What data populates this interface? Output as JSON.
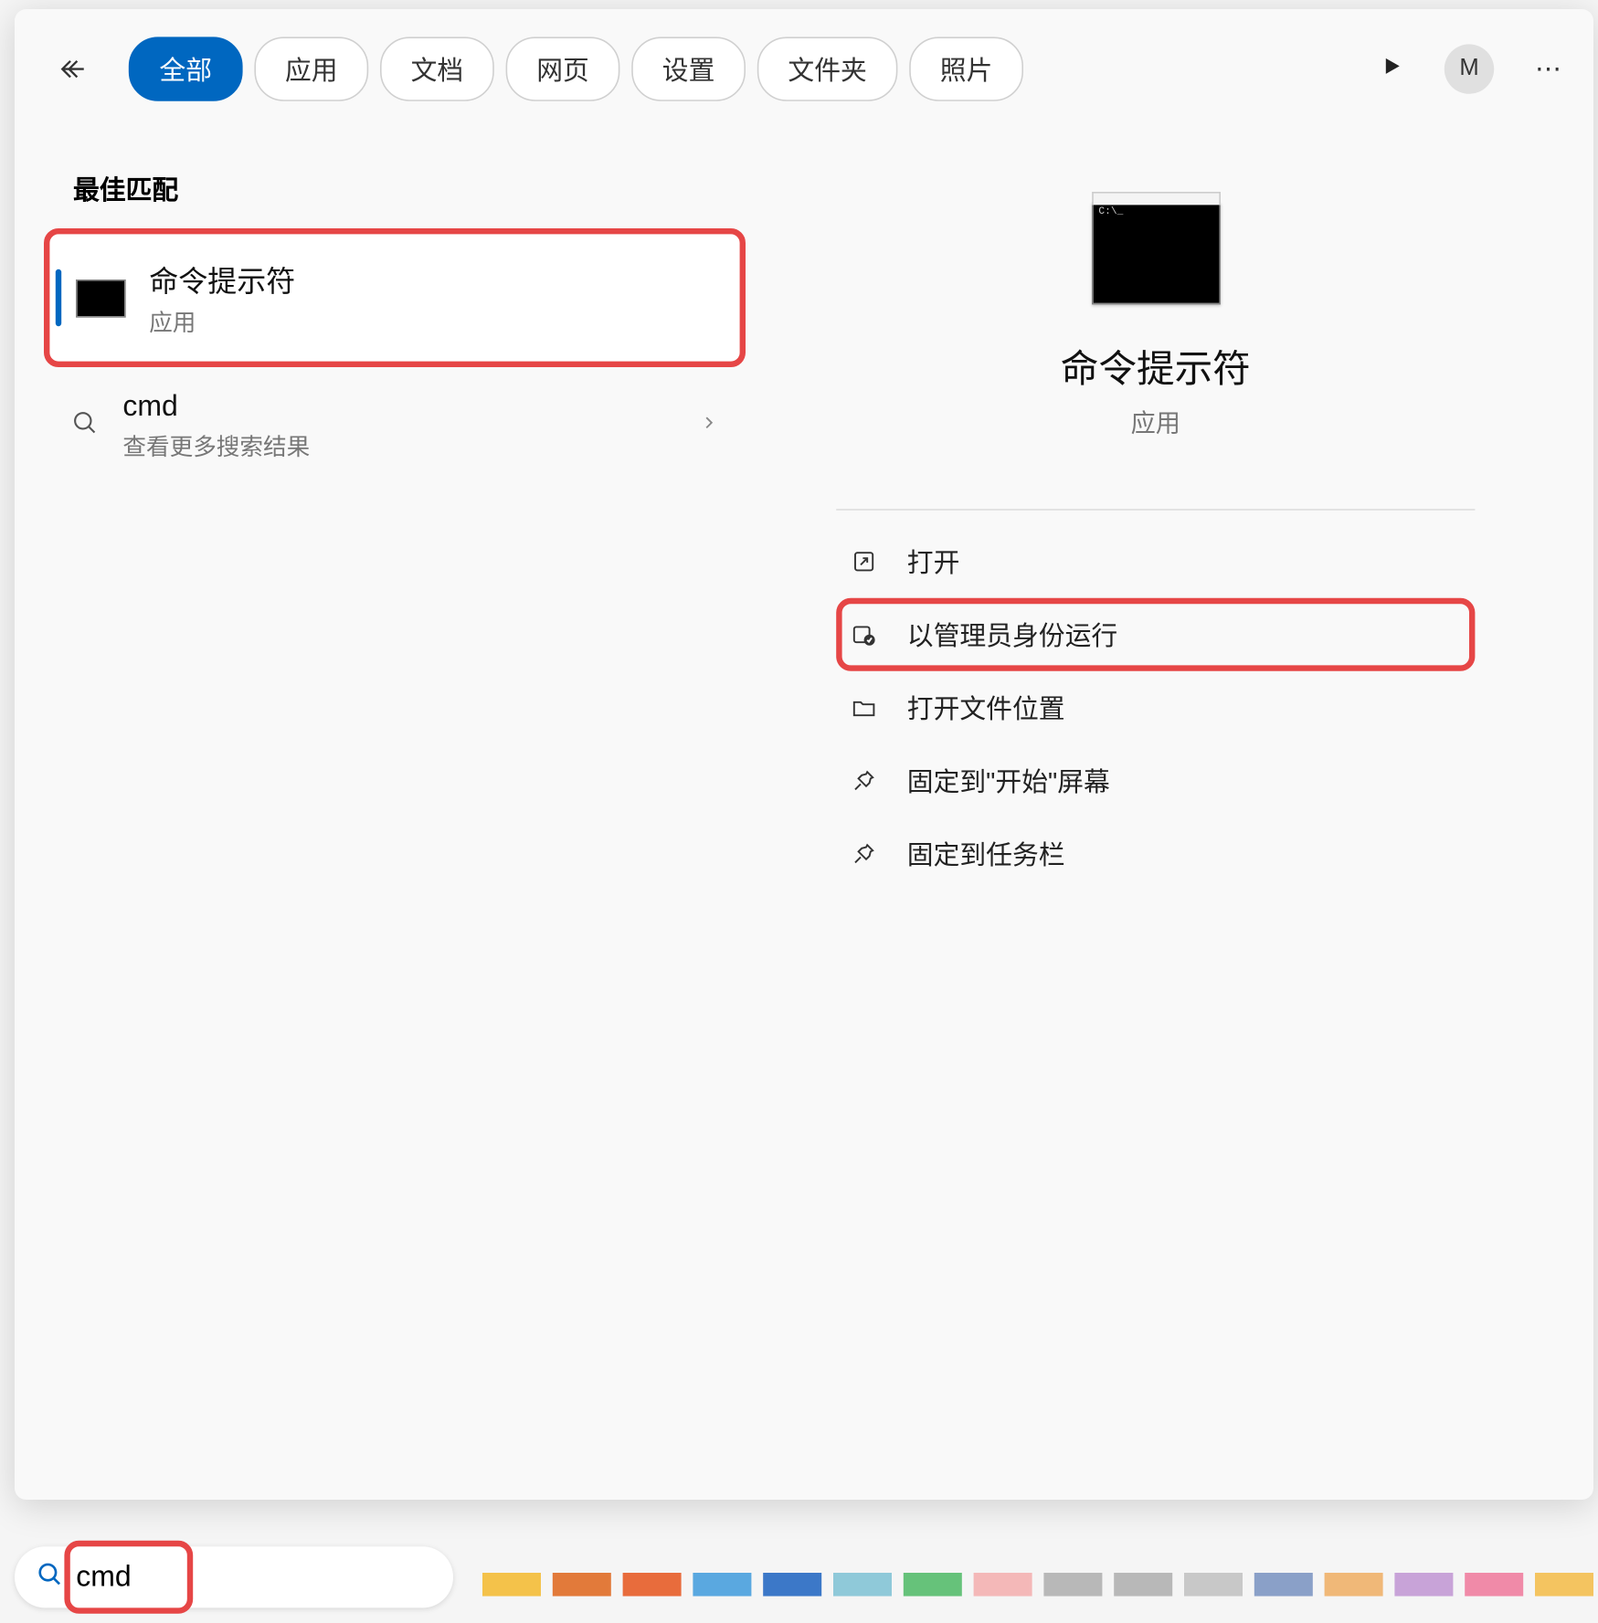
{
  "header": {
    "tabs": [
      {
        "label": "全部",
        "active": true
      },
      {
        "label": "应用",
        "active": false
      },
      {
        "label": "文档",
        "active": false
      },
      {
        "label": "网页",
        "active": false
      },
      {
        "label": "设置",
        "active": false
      },
      {
        "label": "文件夹",
        "active": false
      },
      {
        "label": "照片",
        "active": false
      }
    ],
    "avatar_letter": "M"
  },
  "left": {
    "section_heading": "最佳匹配",
    "results": [
      {
        "title": "命令提示符",
        "subtitle": "应用",
        "icon": "cmd",
        "selected": true,
        "highlighted": true
      },
      {
        "title": "cmd",
        "subtitle": "查看更多搜索结果",
        "icon": "search",
        "selected": false,
        "highlighted": false
      }
    ]
  },
  "right": {
    "preview_title": "命令提示符",
    "preview_subtitle": "应用",
    "actions": [
      {
        "label": "打开",
        "icon": "open",
        "highlighted": false
      },
      {
        "label": "以管理员身份运行",
        "icon": "admin",
        "highlighted": true
      },
      {
        "label": "打开文件位置",
        "icon": "folder",
        "highlighted": false
      },
      {
        "label": "固定到\"开始\"屏幕",
        "icon": "pin",
        "highlighted": false
      },
      {
        "label": "固定到任务栏",
        "icon": "pin",
        "highlighted": false
      }
    ]
  },
  "footer": {
    "search_value": "cmd",
    "highlighted": true
  },
  "taskbar_swatches": [
    "#f4c24a",
    "#e27a3a",
    "#e86c3c",
    "#5aa8e0",
    "#3c78c8",
    "#8fc9d9",
    "#66c27a",
    "#f4b8b8",
    "#b8b8b8",
    "#b8b8b8",
    "#c8c8c8",
    "#8aa0c8",
    "#f0b878",
    "#c8a3d8",
    "#f08aa8",
    "#f4c460",
    "#8ac8a0",
    "#cfcfcf",
    "#e8c96b"
  ]
}
